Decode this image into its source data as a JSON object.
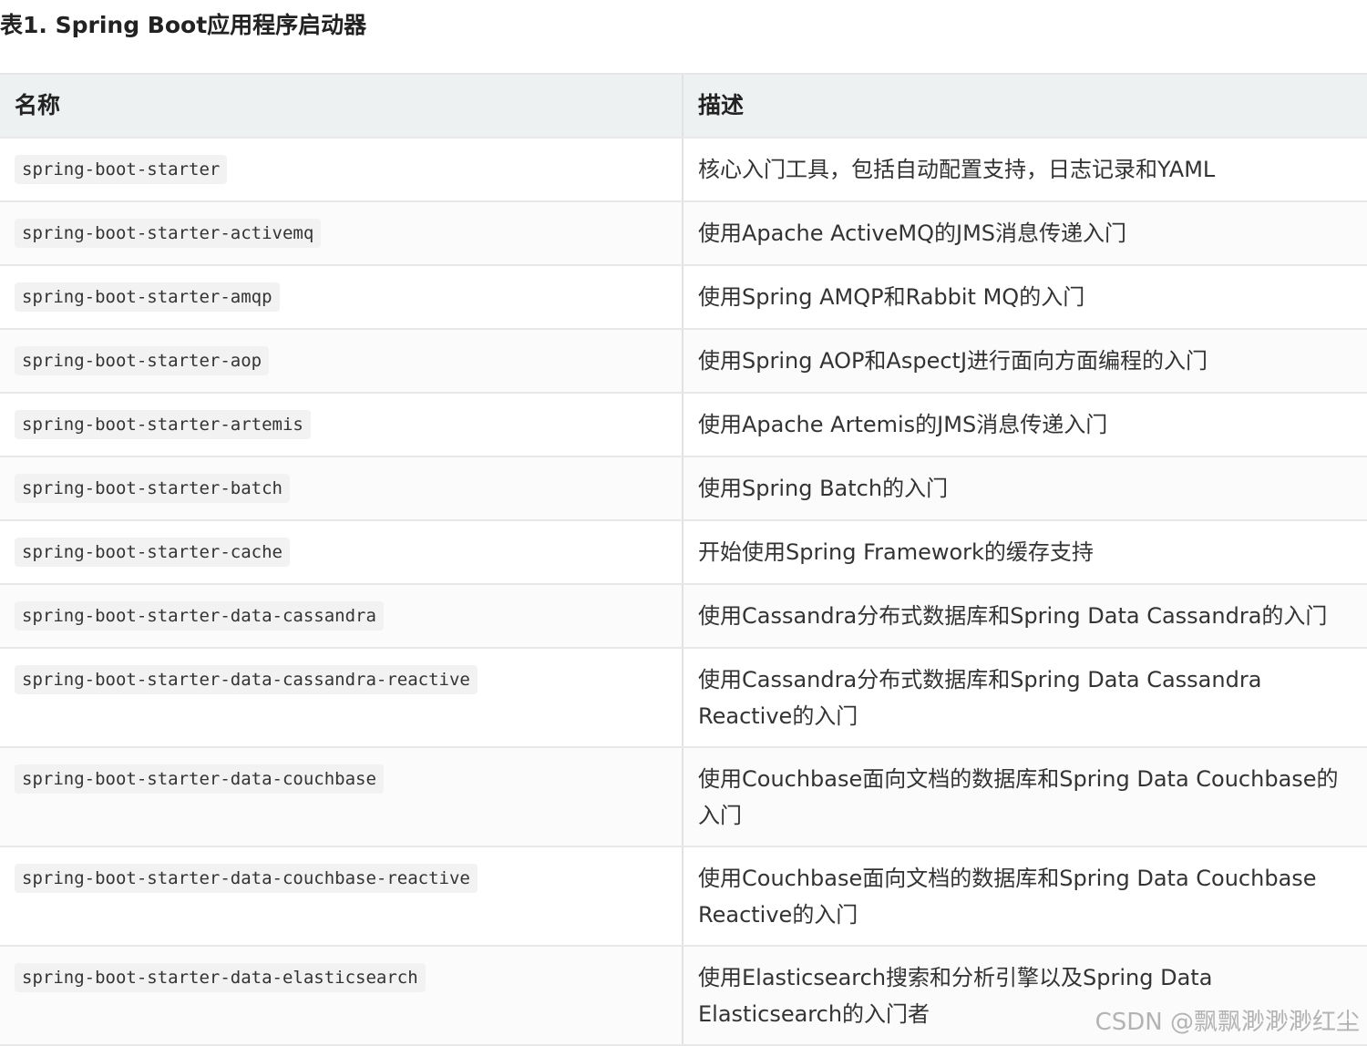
{
  "caption": "表1. Spring Boot应用程序启动器",
  "table": {
    "headers": {
      "name": "名称",
      "description": "描述"
    },
    "rows": [
      {
        "name": "spring-boot-starter",
        "description": "核心入门工具，包括自动配置支持，日志记录和YAML"
      },
      {
        "name": "spring-boot-starter-activemq",
        "description": "使用Apache ActiveMQ的JMS消息传递入门"
      },
      {
        "name": "spring-boot-starter-amqp",
        "description": "使用Spring AMQP和Rabbit MQ的入门"
      },
      {
        "name": "spring-boot-starter-aop",
        "description": "使用Spring AOP和AspectJ进行面向方面编程的入门"
      },
      {
        "name": "spring-boot-starter-artemis",
        "description": "使用Apache Artemis的JMS消息传递入门"
      },
      {
        "name": "spring-boot-starter-batch",
        "description": "使用Spring Batch的入门"
      },
      {
        "name": "spring-boot-starter-cache",
        "description": "开始使用Spring Framework的缓存支持"
      },
      {
        "name": "spring-boot-starter-data-cassandra",
        "description": "使用Cassandra分布式数据库和Spring Data Cassandra的入门"
      },
      {
        "name": "spring-boot-starter-data-cassandra-reactive",
        "description": "使用Cassandra分布式数据库和Spring Data Cassandra Reactive的入门"
      },
      {
        "name": "spring-boot-starter-data-couchbase",
        "description": "使用Couchbase面向文档的数据库和Spring Data Couchbase的入门"
      },
      {
        "name": "spring-boot-starter-data-couchbase-reactive",
        "description": "使用Couchbase面向文档的数据库和Spring Data Couchbase Reactive的入门"
      },
      {
        "name": "spring-boot-starter-data-elasticsearch",
        "description": "使用Elasticsearch搜索和分析引擎以及Spring Data Elasticsearch的入门者"
      }
    ]
  },
  "watermark": "CSDN @飘飘渺渺渺红尘"
}
